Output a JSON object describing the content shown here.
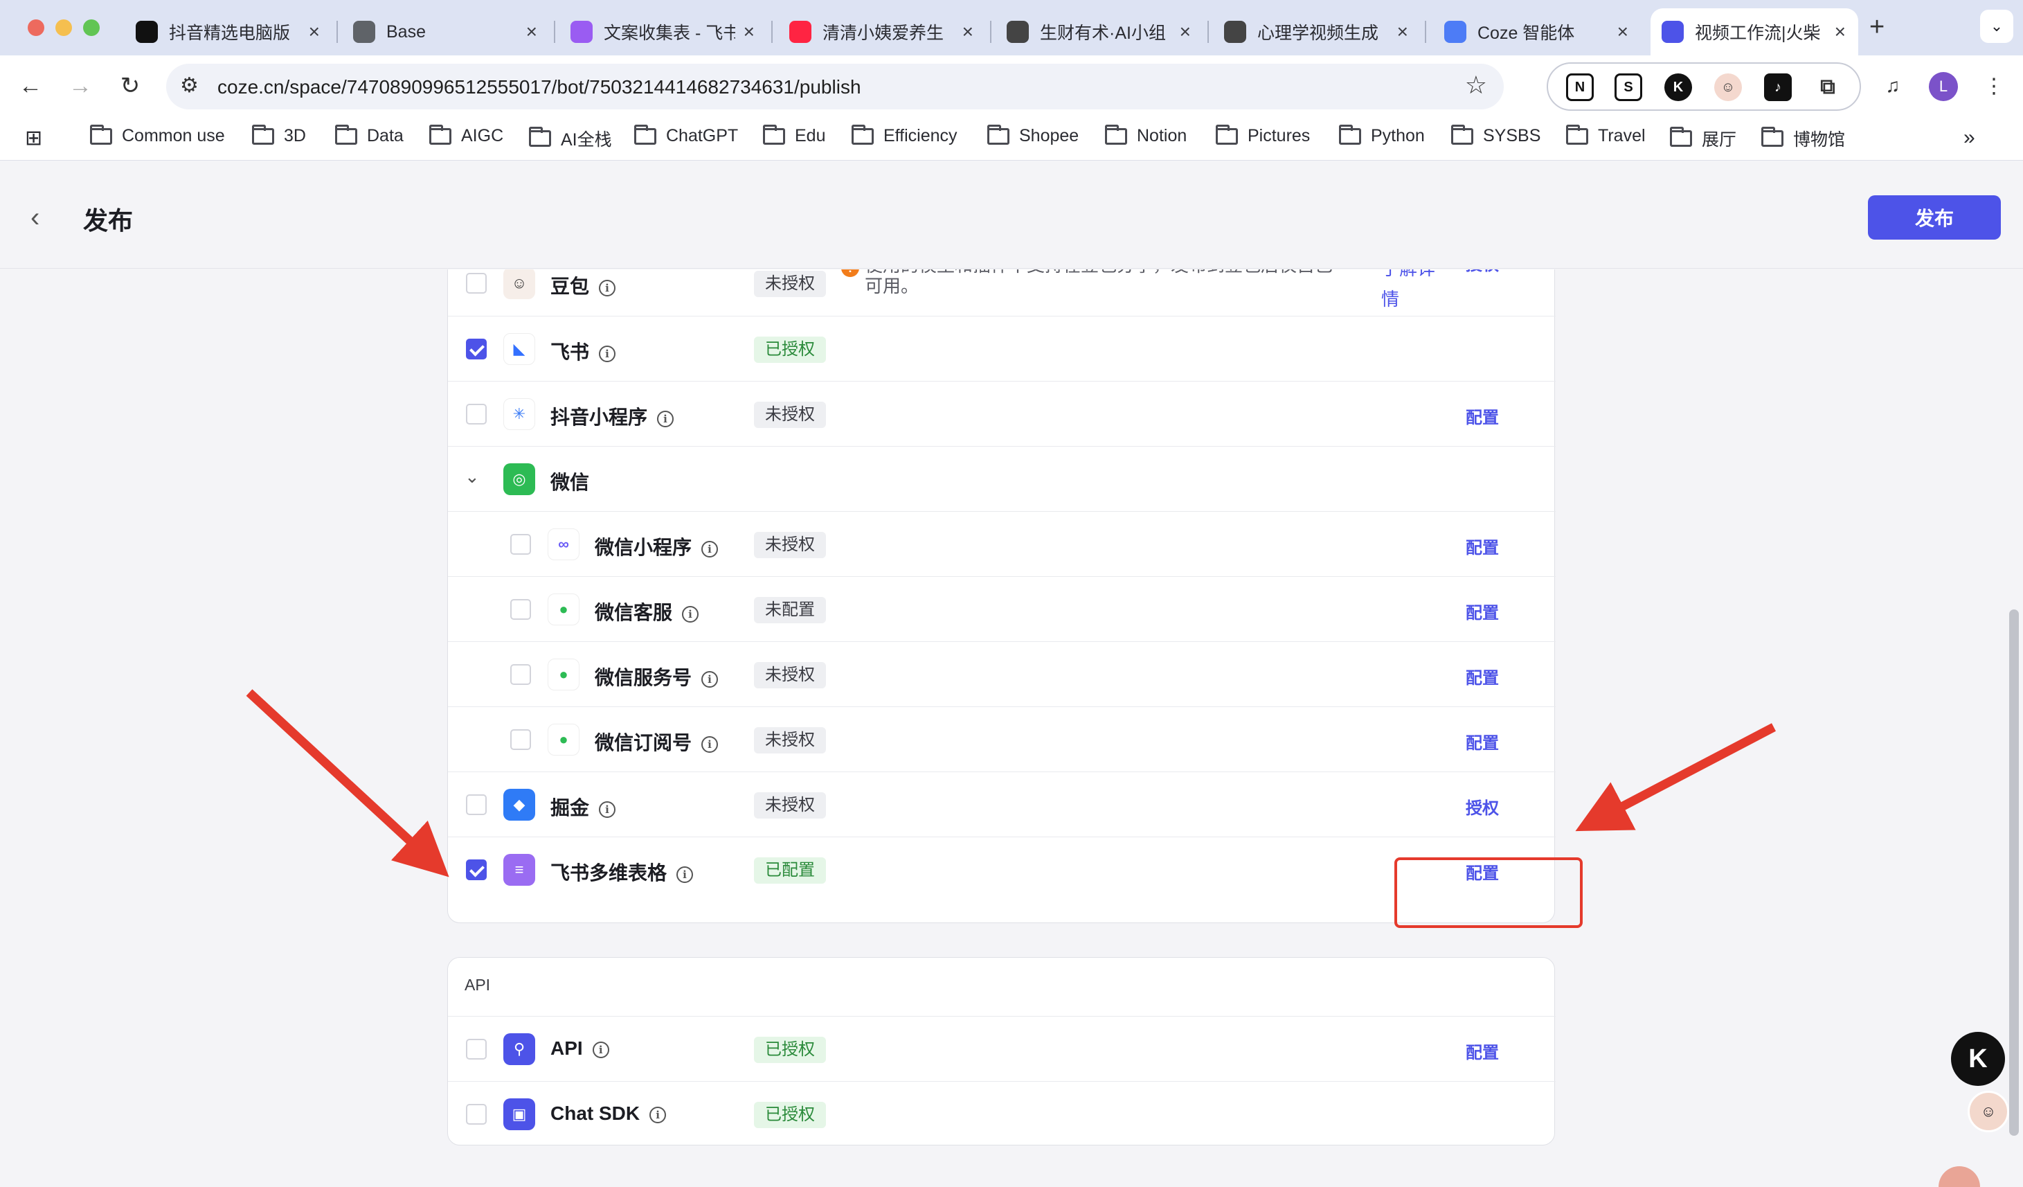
{
  "browser": {
    "tabs": [
      {
        "title": "抖音精选电脑版",
        "favicon": "tiktok-icon",
        "color": "#111111"
      },
      {
        "title": "Base",
        "favicon": "globe-icon",
        "color": "#5f6368"
      },
      {
        "title": "文案收集表 - 飞书",
        "favicon": "lark-base-icon",
        "color": "#9a5cf2"
      },
      {
        "title": "清清小姨爱养生",
        "favicon": "xiaohongshu-icon",
        "color": "#ff2442"
      },
      {
        "title": "生财有术·AI小组",
        "favicon": "coin-icon",
        "color": "#444444"
      },
      {
        "title": "心理学视频生成",
        "favicon": "coin-icon",
        "color": "#444444"
      },
      {
        "title": "Coze 智能体",
        "favicon": "doc-icon",
        "color": "#4d7cf6"
      },
      {
        "title": "视频工作流|火柴",
        "favicon": "coze-icon",
        "color": "#4d53e8",
        "active": true
      }
    ],
    "url": "coze.cn/space/7470890996512555017/bot/7503214414682734631/publish",
    "profile_initial": "L",
    "bookmarks": [
      "Common use",
      "3D",
      "Data",
      "AIGC",
      "AI全栈",
      "ChatGPT",
      "Edu",
      "Efficiency",
      "Shopee",
      "Notion",
      "Pictures",
      "Python",
      "SYSBS",
      "Travel",
      "展厅",
      "博物馆"
    ]
  },
  "page": {
    "title": "发布",
    "publish_button": "发布"
  },
  "platforms": [
    {
      "name": "豆包",
      "badge": "未授权",
      "badge_ok": false,
      "checked": false,
      "action": "授权",
      "icon": "doubao-avatar-icon",
      "icon_color": "#f6eee9",
      "warning": "使用的模型和插件不支持在豆包分享，发布到豆包后仅自己可用。",
      "detail_link": "了解详情"
    },
    {
      "name": "飞书",
      "badge": "已授权",
      "badge_ok": true,
      "checked": true,
      "action": "",
      "icon": "feishu-icon",
      "icon_color": "#ffffff"
    },
    {
      "name": "抖音小程序",
      "badge": "未授权",
      "badge_ok": false,
      "checked": false,
      "action": "配置",
      "icon": "douyin-miniapp-icon",
      "icon_color": "#ffffff"
    },
    {
      "name": "微信",
      "group": true,
      "icon": "wechat-icon",
      "icon_color": "#2dbb54"
    },
    {
      "name": "微信小程序",
      "badge": "未授权",
      "badge_ok": false,
      "checked": false,
      "action": "配置",
      "indent": true,
      "icon": "wechat-miniprogram-icon",
      "icon_color": "#ffffff"
    },
    {
      "name": "微信客服",
      "badge": "未配置",
      "badge_ok": false,
      "checked": false,
      "action": "配置",
      "indent": true,
      "icon": "wechat-service-icon",
      "icon_color": "#ffffff"
    },
    {
      "name": "微信服务号",
      "badge": "未授权",
      "badge_ok": false,
      "checked": false,
      "action": "配置",
      "indent": true,
      "icon": "wechat-official-icon",
      "icon_color": "#ffffff"
    },
    {
      "name": "微信订阅号",
      "badge": "未授权",
      "badge_ok": false,
      "checked": false,
      "action": "配置",
      "indent": true,
      "icon": "wechat-subscription-icon",
      "icon_color": "#ffffff"
    },
    {
      "name": "掘金",
      "badge": "未授权",
      "badge_ok": false,
      "checked": false,
      "action": "授权",
      "icon": "juejin-icon",
      "icon_color": "#2f7bf6"
    },
    {
      "name": "飞书多维表格",
      "badge": "已配置",
      "badge_ok": true,
      "checked": true,
      "action": "配置",
      "icon": "lark-base-icon",
      "icon_color": "#9a6cf2"
    }
  ],
  "api_section": {
    "label": "API",
    "items": [
      {
        "name": "API",
        "badge": "已授权",
        "badge_ok": true,
        "checked": false,
        "action": "配置",
        "icon": "api-link-icon",
        "icon_color": "#4d53e8"
      },
      {
        "name": "Chat SDK",
        "badge": "已授权",
        "badge_ok": true,
        "checked": false,
        "action": "",
        "icon": "chat-sdk-icon",
        "icon_color": "#4d53e8"
      }
    ]
  },
  "colors": {
    "accent": "#4d53e8",
    "annotation": "#e53a2c",
    "ok_badge": "#2a8a3a"
  }
}
